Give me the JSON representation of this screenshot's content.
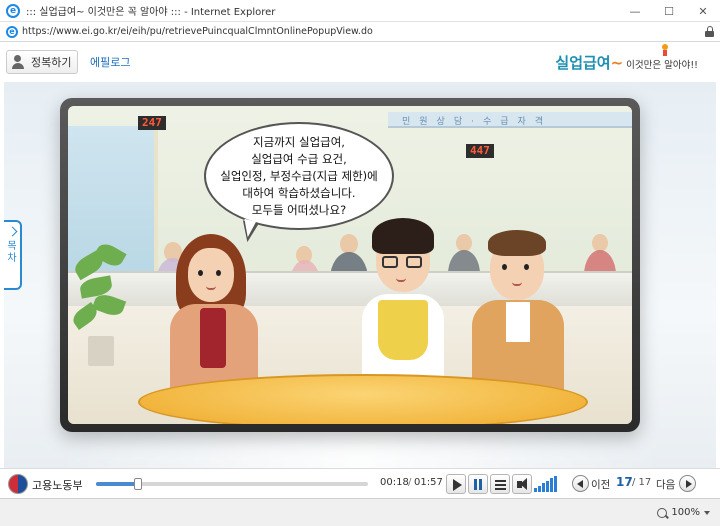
{
  "window": {
    "title": "::: 실업급여~ 이것만은 꼭 알아야 ::: - Internet Explorer",
    "controls": [
      "—",
      "☐",
      "✕"
    ]
  },
  "address": {
    "url": "https://www.ei.go.kr/ei/eih/pu/retrievePuincqualClmntOnlinePopupView.do"
  },
  "header": {
    "abstract_button": "정복하기",
    "epilogue_link": "에필로그",
    "brand_main": "실업급여",
    "brand_tilde": "~",
    "brand_sub": "이것만은 알아야!!"
  },
  "side_tab": {
    "label": "목차"
  },
  "scene": {
    "sign_text": "민원상담·수급자격",
    "ticket_left": "247",
    "ticket_right": "447",
    "speech": "지금까지 실업급여,\n실업급여 수급 요건,\n실업인정, 부정수급(지급 제한)에\n대하여 학습하셨습니다.\n모두들 어떠셨나요?"
  },
  "player": {
    "org_name": "고용노동부",
    "current_time": "00:18",
    "total_time": "01:57",
    "progress": 0.154,
    "volume_level": 6,
    "volume_max": 6,
    "prev_label": "이전",
    "next_label": "다음",
    "page_current": "17",
    "page_total": "/ 17"
  },
  "status": {
    "zoom": "100%"
  },
  "colors": {
    "accent": "#1c8fb2",
    "link": "#1b6fbf",
    "tab_border": "#2a8ad1",
    "page_number": "#1e5fa8"
  }
}
